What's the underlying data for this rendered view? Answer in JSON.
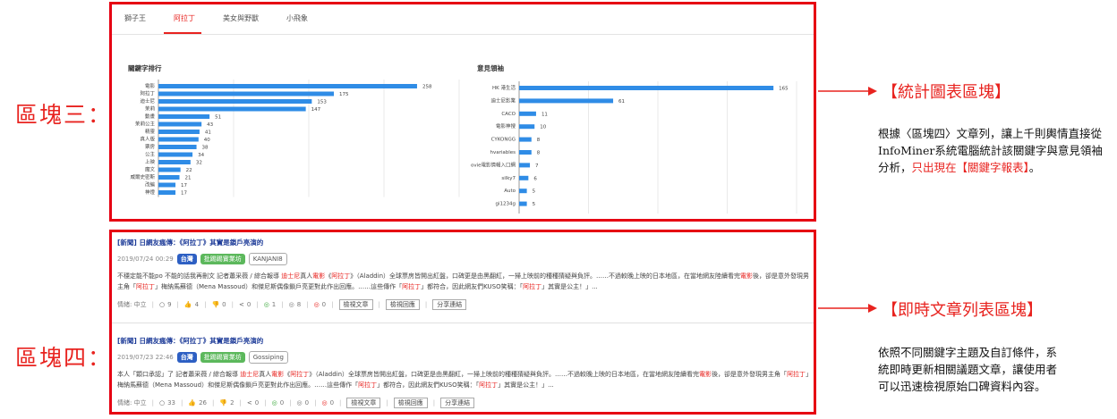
{
  "labels": {
    "section3": "區塊三：",
    "section4": "區塊四："
  },
  "tabs": [
    "獅子王",
    "阿拉丁",
    "美女與野獸",
    "小飛象"
  ],
  "active_tab": "阿拉丁",
  "chart_data": [
    {
      "type": "bar",
      "orientation": "horizontal",
      "title": "關鍵字排行",
      "categories": [
        "電影",
        "阿拉丁",
        "迪士尼",
        "茉莉",
        "動畫",
        "茉莉公主",
        "精靈",
        "真人版",
        "票房",
        "公主",
        "上映",
        "魔文",
        "威爾史密斯",
        "改編",
        "神燈"
      ],
      "values": [
        258,
        175,
        153,
        147,
        51,
        43,
        41,
        40,
        38,
        34,
        32,
        22,
        21,
        17,
        17
      ],
      "xlim": [
        0,
        300
      ],
      "grid": true,
      "color": "#2f8ce6"
    },
    {
      "type": "bar",
      "orientation": "horizontal",
      "title": "意見領袖",
      "categories": [
        "HK 港生活",
        "迪士尼影業",
        "CACO",
        "電影神搜",
        "CYKONGG",
        "hvariables",
        "ovie電影情報入口網",
        "silky7",
        "Auto",
        "gi1234g"
      ],
      "values": [
        165,
        61,
        11,
        10,
        8,
        8,
        7,
        6,
        5,
        5
      ],
      "xlim": [
        0,
        180
      ],
      "grid": true,
      "color": "#2f8ce6"
    }
  ],
  "articles": [
    {
      "title": "[新聞] 日網友瘋傳：《阿拉丁》其實是鎖戶亮演的",
      "date": "2019/07/24 00:29",
      "tags": [
        "台灣",
        "批踢踢實業坊",
        "KANJANI8"
      ],
      "body_parts": [
        {
          "t": "不穩定能不能po 不能的話我再刪文 記者蕭采薇 / 綜合報導 ",
          "h": false
        },
        {
          "t": "迪士尼",
          "h": true
        },
        {
          "t": "真人",
          "h": false
        },
        {
          "t": "電影",
          "h": true
        },
        {
          "t": "《",
          "h": false
        },
        {
          "t": "阿拉丁",
          "h": true
        },
        {
          "t": "》（Aladdin）全球票房皆開出紅盤，口碑更是由黑翻紅，一掃上映前的種種猜疑與負評。……不過較晚上映的日本地區，在當地網友陸續看完",
          "h": false
        },
        {
          "t": "電影",
          "h": true
        },
        {
          "t": "後，卻是意外發現男主角「",
          "h": false
        },
        {
          "t": "阿拉丁",
          "h": true
        },
        {
          "t": "」梅納馬蘇德（Mena Massoud）和傑尼斯偶像鎖戶亮更對此作出回應。……這些傳作「",
          "h": false
        },
        {
          "t": "阿拉丁",
          "h": true
        },
        {
          "t": "」都符合，因此網友們KUSO笑稱：「",
          "h": false
        },
        {
          "t": "阿拉丁",
          "h": true
        },
        {
          "t": "」其實是公主！」...",
          "h": false
        }
      ],
      "stats": {
        "sentiment": "情緒: 中立",
        "views": "9",
        "likes": "4",
        "dislikes": "0",
        "shares": "0",
        "positive": "1",
        "neutral": "8",
        "negative": "0"
      },
      "buttons": [
        "檢視文章",
        "檢視回應",
        "分享連結"
      ]
    },
    {
      "title": "[新聞] 日網友瘋傳：《阿拉丁》其實是鎖戶亮演的",
      "date": "2019/07/23 22:46",
      "tags": [
        "台灣",
        "批踢踢實業坊",
        "Gossiping"
      ],
      "body_parts": [
        {
          "t": "本人「顆口承認」了 記者蕭采薇 / 綜合報導 ",
          "h": false
        },
        {
          "t": "迪士尼",
          "h": true
        },
        {
          "t": "真人",
          "h": false
        },
        {
          "t": "電影",
          "h": true
        },
        {
          "t": "《",
          "h": false
        },
        {
          "t": "阿拉丁",
          "h": true
        },
        {
          "t": "》（Aladdin）全球票房皆開出紅盤，口碑更是由黑翻紅，一掃上映前的種種猜疑與負評。……不過較晚上映的日本地區，在當地網友陸續看完",
          "h": false
        },
        {
          "t": "電影",
          "h": true
        },
        {
          "t": "後，卻是意外發現男主角「",
          "h": false
        },
        {
          "t": "阿拉丁",
          "h": true
        },
        {
          "t": "」梅納馬蘇德（Mena Massoud）和傑尼斯偶像鎖戶亮更對此作出回應。……這些傳作「",
          "h": false
        },
        {
          "t": "阿拉丁",
          "h": true
        },
        {
          "t": "」都符合，因此網友們KUSO笑稱：「",
          "h": false
        },
        {
          "t": "阿拉丁",
          "h": true
        },
        {
          "t": "」其實是公主！」...",
          "h": false
        }
      ],
      "stats": {
        "sentiment": "情緒: 中立",
        "views": "33",
        "likes": "26",
        "dislikes": "2",
        "shares": "0",
        "positive": "0",
        "neutral": "0",
        "negative": "0"
      },
      "buttons": [
        "檢視文章",
        "檢視回應",
        "分享連結"
      ]
    }
  ],
  "callouts": {
    "stats_title": "【統計圖表區塊】",
    "stats_desc_parts": [
      {
        "t": "根據〈區塊四〉文章列，讓上千則輿情直接從InfoMiner系統電腦統計該關鍵字與意見領袖分析，",
        "h": false
      },
      {
        "t": "只出現在【關鍵字報表】",
        "h": true
      },
      {
        "t": "。",
        "h": false
      }
    ],
    "list_title": "【即時文章列表區塊】",
    "list_desc": "依照不同關鍵字主題及自訂條件，系統即時更新相關議題文章，讓使用者可以迅速檢視原始口碑資料內容。"
  },
  "colors": {
    "accent": "#e8231f",
    "frame": "#e60012",
    "bar": "#2f8ce6"
  }
}
